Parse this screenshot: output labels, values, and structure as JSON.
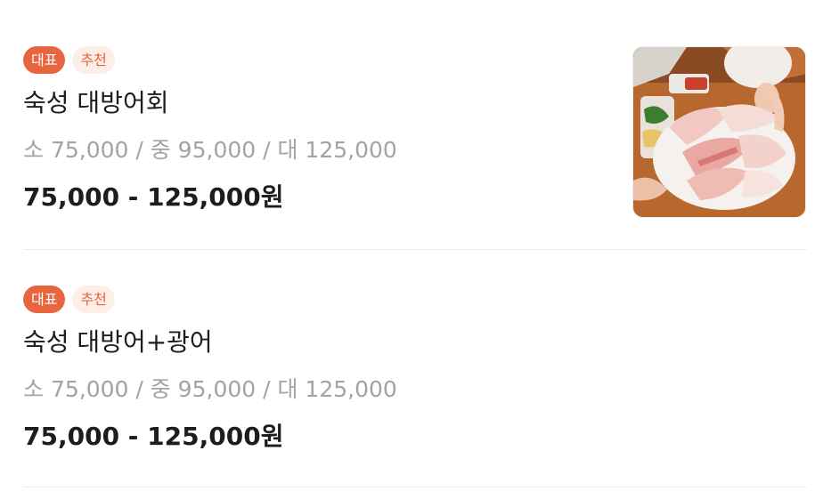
{
  "menu": {
    "items": [
      {
        "badges": {
          "main": "대표",
          "recommended": "추천"
        },
        "name": "숙성 대방어회",
        "options": "소 75,000 / 중 95,000 / 대 125,000",
        "price": "75,000 - 125,000원",
        "has_image": true
      },
      {
        "badges": {
          "main": "대표",
          "recommended": "추천"
        },
        "name": "숙성 대방어+광어",
        "options": "소 75,000 / 중 95,000 / 대 125,000",
        "price": "75,000 - 125,000원",
        "has_image": false
      }
    ]
  },
  "colors": {
    "accent": "#e8663f",
    "accent_soft": "#fdeee8",
    "muted_text": "#a3a3a3",
    "divider": "#ececec"
  }
}
